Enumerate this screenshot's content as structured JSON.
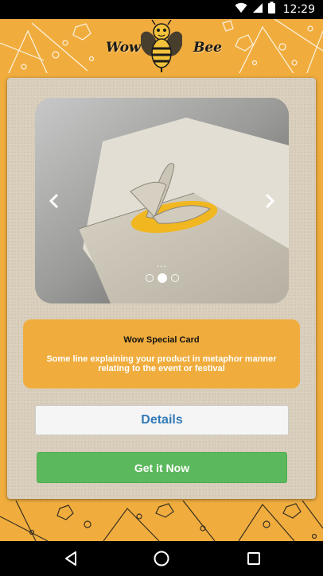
{
  "status_bar": {
    "time": "12:29",
    "icons": [
      "wifi-icon",
      "signal-icon",
      "battery-icon"
    ]
  },
  "header": {
    "logo_left": "Wow",
    "logo_right": "Bee",
    "logo_icon": "bee-icon"
  },
  "carousel": {
    "image": "butterfly-popup-card-photo",
    "overlay_text": "...",
    "slide_count": 3,
    "active_slide": 2,
    "prev_icon": "chevron-left-icon",
    "next_icon": "chevron-right-icon"
  },
  "product": {
    "title": "Wow Special Card",
    "description": "Some line explaining your product in metaphor manner relating to the event or festival"
  },
  "actions": {
    "details_label": "Details",
    "get_label": "Get it Now"
  },
  "nav_bar": {
    "icons": [
      "back-icon",
      "home-icon",
      "recents-icon"
    ]
  },
  "colors": {
    "accent": "#f0ad3e",
    "panel": "#d9cfbc",
    "details_text": "#337ab7",
    "get_button": "#5cb85c"
  }
}
